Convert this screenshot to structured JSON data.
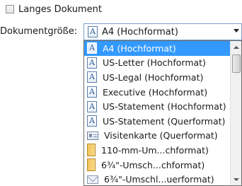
{
  "options": {
    "long_document_label": "Langes Dokument",
    "long_document_checked": false
  },
  "document_size": {
    "label": "Dokumentgröße:",
    "selected": "A4 (Hochformat)",
    "selected_icon": "page-icon"
  },
  "dropdown": {
    "items": [
      {
        "label": "A4 (Hochformat)",
        "icon": "page-icon",
        "selected": true
      },
      {
        "label": "US-Letter (Hochformat)",
        "icon": "page-icon",
        "selected": false
      },
      {
        "label": "US-Legal (Hochformat)",
        "icon": "page-icon",
        "selected": false
      },
      {
        "label": "Executive (Hochformat)",
        "icon": "page-icon",
        "selected": false
      },
      {
        "label": "US-Statement (Hochformat)",
        "icon": "page-icon",
        "selected": false
      },
      {
        "label": "US-Statement (Querformat)",
        "icon": "page-icon",
        "selected": false
      },
      {
        "label": "Visitenkarte (Querformat)",
        "icon": "business-card-icon",
        "selected": false
      },
      {
        "label": "110-mm-Um...chformat)",
        "icon": "envelope-portrait-icon",
        "selected": false
      },
      {
        "label": "6¾\"-Umsch...chformat)",
        "icon": "envelope-portrait-icon",
        "selected": false
      },
      {
        "label": "6¾\"-Umschl...uerformat)",
        "icon": "envelope-landscape-icon",
        "selected": false
      }
    ]
  },
  "colors": {
    "selection": "#3399ff",
    "combo_border": "#7a9fcf",
    "page_icon": "#2f5f96"
  }
}
